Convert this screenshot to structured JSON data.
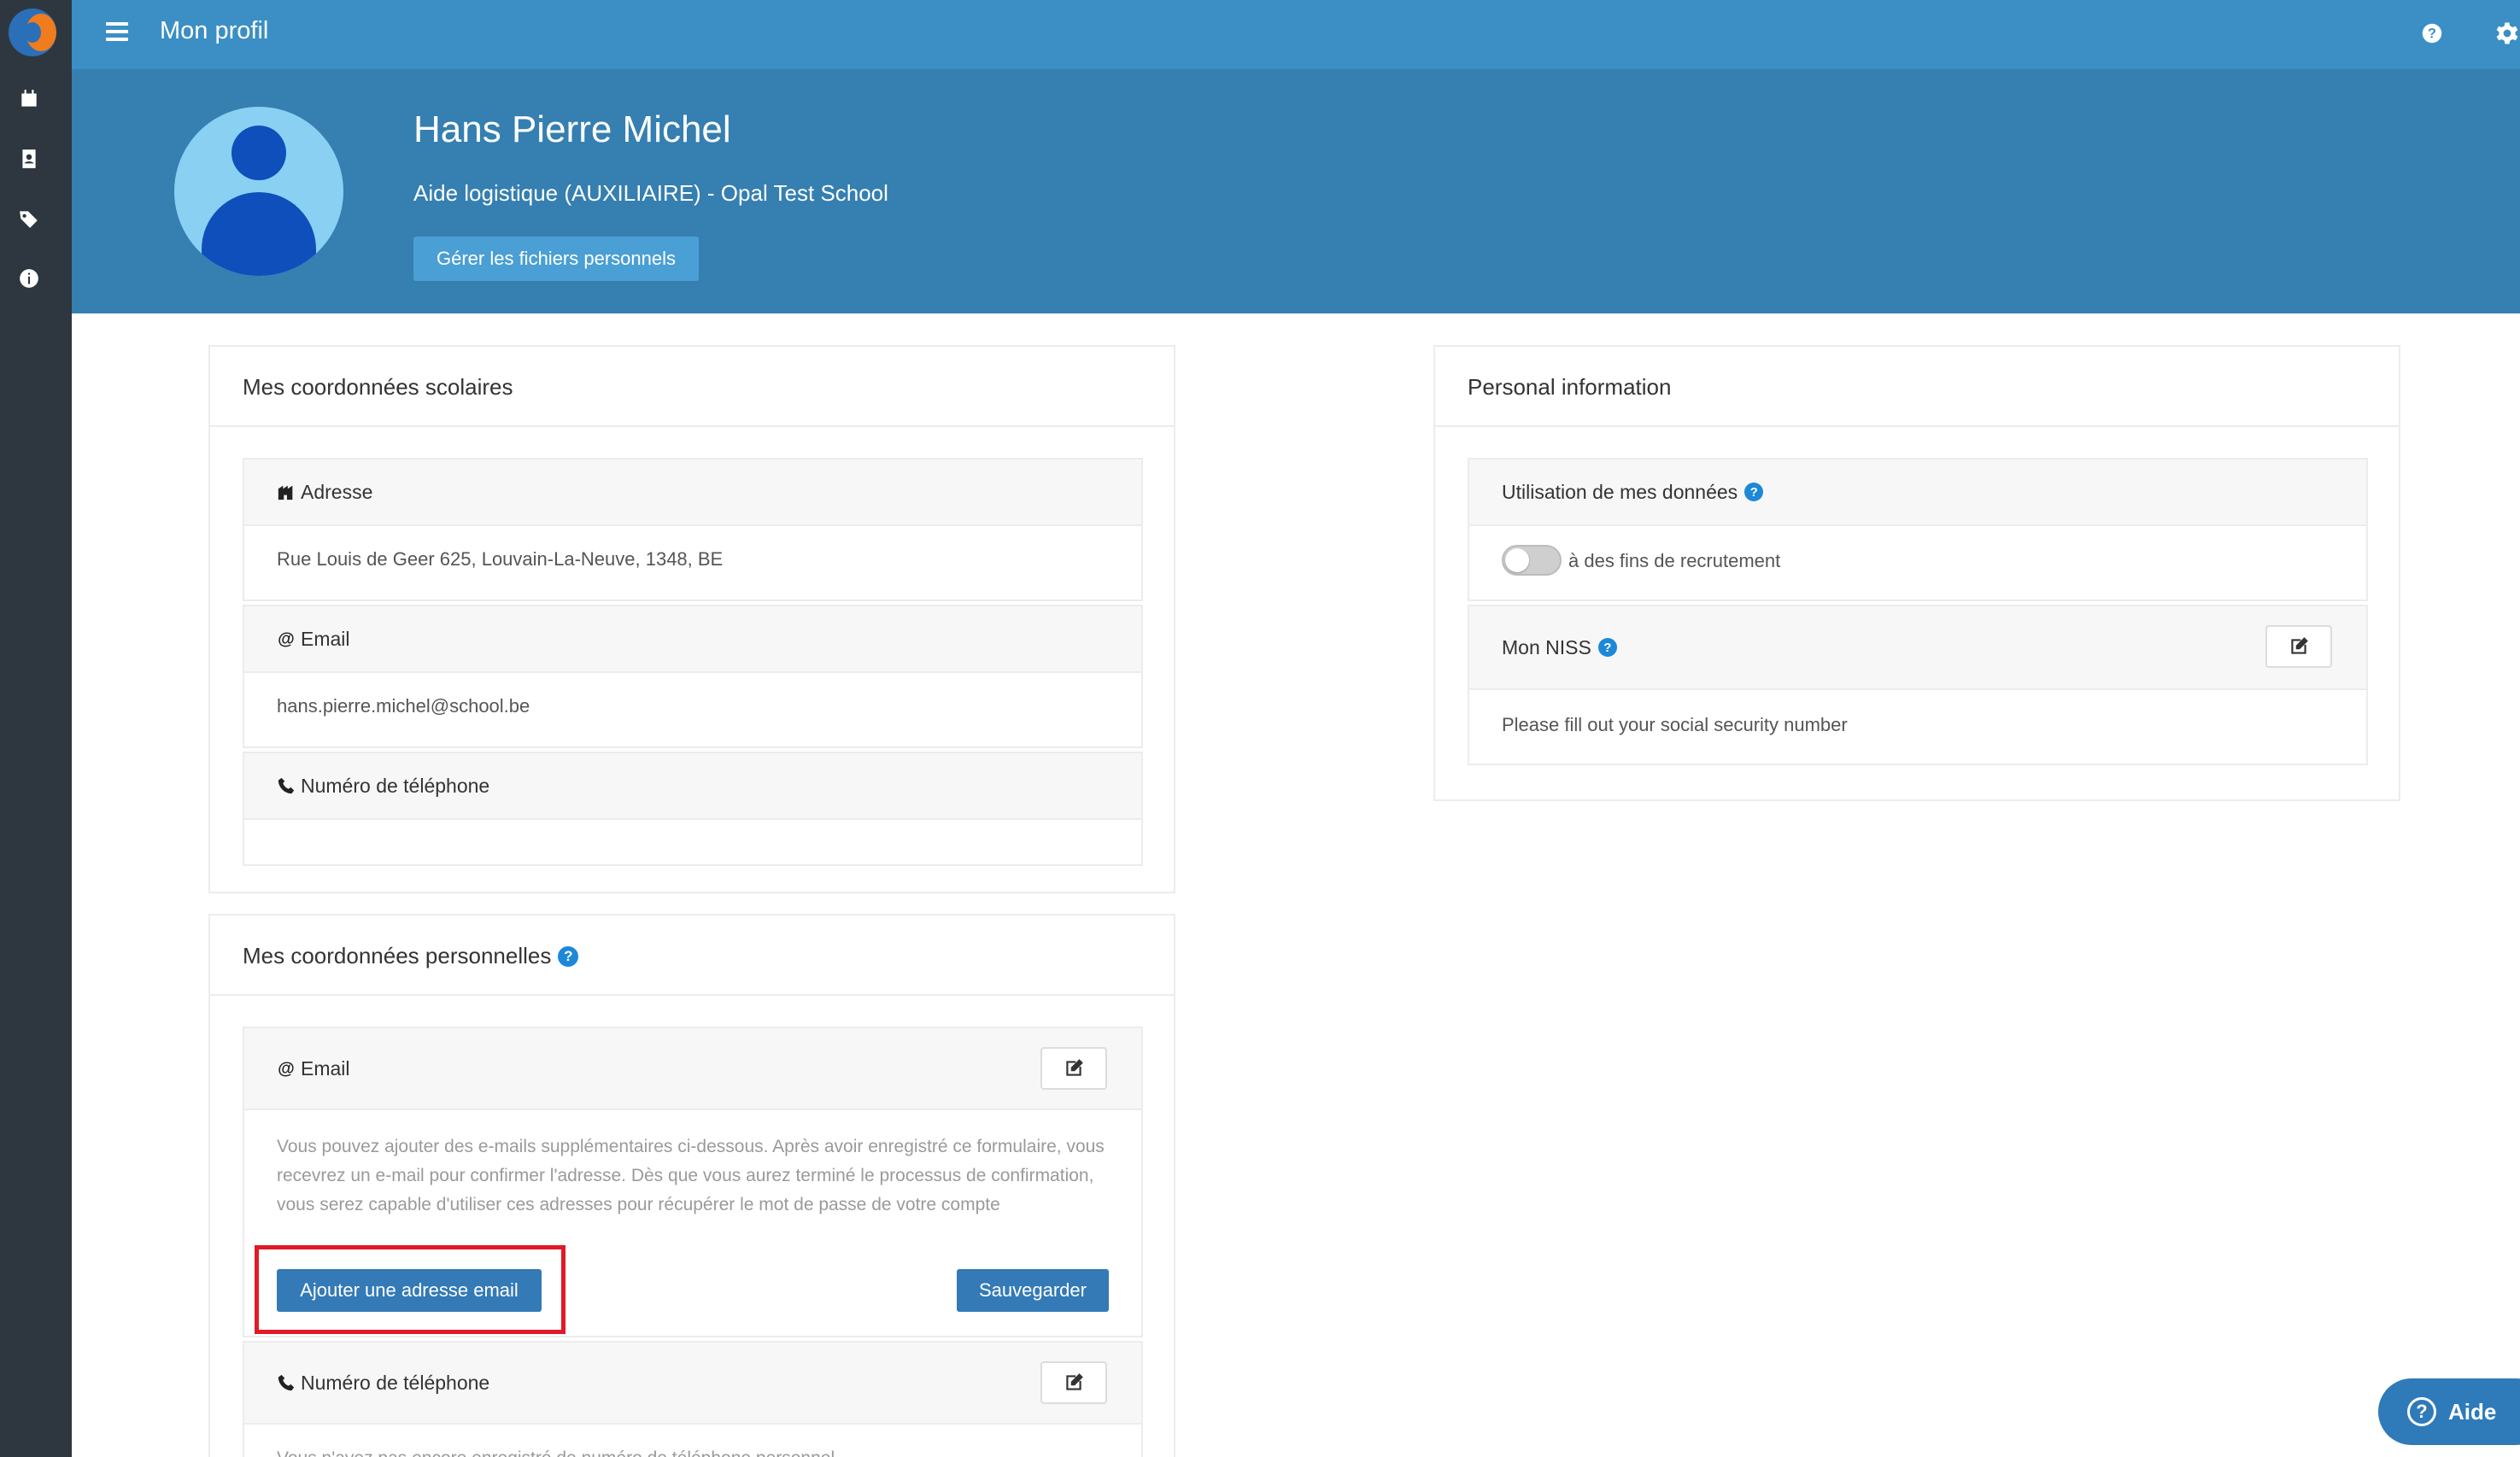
{
  "app": {
    "title": "Mon profil"
  },
  "profile": {
    "name": "Hans Pierre Michel",
    "role": "Aide logistique (AUXILIAIRE) - Opal Test School",
    "files_button": "Gérer les fichiers personnels"
  },
  "school_panel": {
    "title": "Mes coordonnées scolaires",
    "address_label": "Adresse",
    "address_value": "Rue Louis de Geer 625, Louvain-La-Neuve, 1348, BE",
    "email_label": "Email",
    "email_value": "hans.pierre.michel@school.be",
    "phone_label": "Numéro de téléphone",
    "phone_value": ""
  },
  "personal_panel": {
    "title": "Mes coordonnées personnelles",
    "email_label": "Email",
    "email_help_text": "Vous pouvez ajouter des e-mails supplémentaires ci-dessous. Après avoir enregistré ce formulaire, vous recevrez un e-mail pour confirmer l'adresse. Dès que vous aurez terminé le processus de confirmation, vous serez capable d'utiliser ces adresses pour récupérer le mot de passe de votre compte",
    "add_email_button": "Ajouter une adresse email",
    "save_button": "Sauvegarder",
    "phone_label": "Numéro de téléphone",
    "phone_help_text": "Vous n'avez pas encore enregistré de numéro de téléphone personnel"
  },
  "info_panel": {
    "title": "Personal information",
    "data_use_label": "Utilisation de mes données",
    "recruitment_toggle_label": "à des fins de recrutement",
    "recruitment_enabled": false,
    "niss_label": "Mon NISS",
    "niss_value": "Please fill out your social security number"
  },
  "help_fab": {
    "label": "Aide"
  },
  "colors": {
    "topbar": "#3b8fc4",
    "banner": "#357fb1",
    "sidebar": "#2e3740",
    "primary": "#337ab7",
    "highlight": "#e01a27"
  }
}
